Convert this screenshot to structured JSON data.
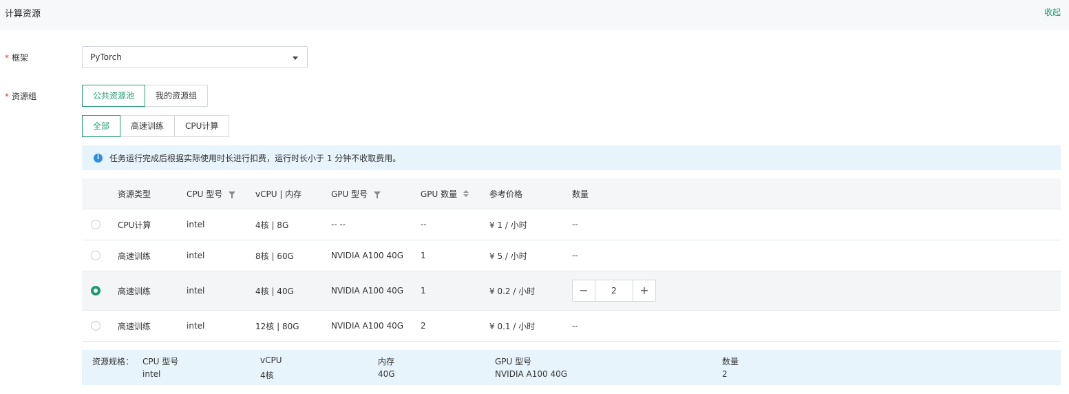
{
  "header": {
    "title": "计算资源",
    "collapse_label": "收起"
  },
  "framework": {
    "label": "框架",
    "required_mark": "*",
    "value": "PyTorch"
  },
  "resource_group": {
    "label": "资源组",
    "required_mark": "*",
    "pool_tabs": [
      {
        "label": "公共资源池",
        "active": true
      },
      {
        "label": "我的资源组",
        "active": false
      }
    ],
    "type_tabs": [
      {
        "label": "全部",
        "active": true
      },
      {
        "label": "高速训练",
        "active": false
      },
      {
        "label": "CPU计算",
        "active": false
      }
    ]
  },
  "notice": {
    "icon": "info-icon",
    "text": "任务运行完成后根据实际使用时长进行扣费，运行时长小于 1 分钟不收取费用。"
  },
  "table": {
    "headers": {
      "type": "资源类型",
      "cpu": "CPU 型号",
      "vcpu": "vCPU | 内存",
      "gpu": "GPU 型号",
      "gpu_count": "GPU 数量",
      "price": "参考价格",
      "qty": "数量"
    },
    "rows": [
      {
        "type": "CPU计算",
        "cpu": "intel",
        "vcpu": "4核 | 8G",
        "gpu": "-- --",
        "gpu_count": "--",
        "price": "¥ 1 / 小时",
        "qty": "--",
        "selected": false
      },
      {
        "type": "高速训练",
        "cpu": "intel",
        "vcpu": "8核 | 60G",
        "gpu": "NVIDIA A100 40G",
        "gpu_count": "1",
        "price": "¥ 5 / 小时",
        "qty": "--",
        "selected": false
      },
      {
        "type": "高速训练",
        "cpu": "intel",
        "vcpu": "4核 | 40G",
        "gpu": "NVIDIA A100 40G",
        "gpu_count": "1",
        "price": "¥ 0.2 / 小时",
        "qty": "2",
        "selected": true
      },
      {
        "type": "高速训练",
        "cpu": "intel",
        "vcpu": "12核 | 80G",
        "gpu": "NVIDIA A100 40G",
        "gpu_count": "2",
        "price": "¥ 0.1 / 小时",
        "qty": "--",
        "selected": false
      }
    ],
    "stepper": {
      "minus": "−",
      "plus": "+"
    }
  },
  "spec": {
    "label": "资源规格：",
    "columns": [
      {
        "head": "CPU 型号",
        "value": "intel"
      },
      {
        "head": "vCPU",
        "value": "4核"
      },
      {
        "head": "内存",
        "value": "40G"
      },
      {
        "head": "GPU 型号",
        "value": "NVIDIA A100 40G"
      },
      {
        "head": "数量",
        "value": "2"
      }
    ]
  },
  "colors": {
    "accent": "#1e9b6e",
    "info": "#2f8ee0",
    "required": "#e4393c"
  }
}
